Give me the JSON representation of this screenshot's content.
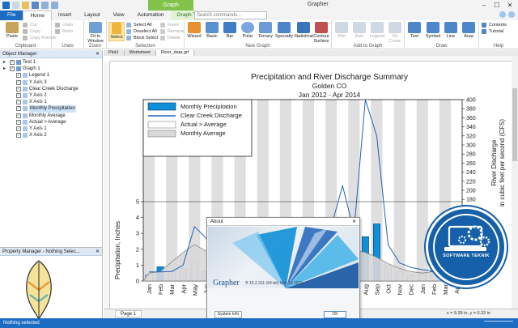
{
  "window": {
    "app_title": "Grapher",
    "contextual_tab": "Graph",
    "search_placeholder": "Search commands..."
  },
  "ribbon": {
    "tabs": [
      "File",
      "Home",
      "Insert",
      "Layout",
      "View",
      "Automation",
      "Graph Tools"
    ],
    "active_tab": "Home",
    "groups": {
      "clipboard": {
        "label": "Clipboard",
        "paste": "Paste",
        "cut": "Cut",
        "copy": "Copy",
        "copy_format": "Copy Format"
      },
      "undo": {
        "label": "Undo",
        "undo": "Undo",
        "redo": "Redo"
      },
      "zoom": {
        "label": "Zoom",
        "fit": "Fit to Window"
      },
      "selection": {
        "label": "Selection",
        "select": "Select",
        "select_all": "Select All",
        "deselect_all": "Deselect All",
        "block_select": "Block Select",
        "invert": "Invert",
        "rename": "Rename",
        "delete": "Delete"
      },
      "new_graph": {
        "label": "New Graph",
        "items": [
          "Wizard",
          "Basic",
          "Bar",
          "Polar",
          "Ternary",
          "Specialty",
          "Statistical",
          "Contour Surface"
        ]
      },
      "add_to_graph": {
        "label": "Add to Graph",
        "items": [
          "Plot",
          "Axis",
          "Legend",
          "Fit Curve"
        ]
      },
      "draw": {
        "label": "Draw",
        "items": [
          "Text",
          "Symbol",
          "Line",
          "Area"
        ]
      },
      "help": {
        "label": "Help",
        "contents": "Contents",
        "tutorial": "Tutorial"
      }
    }
  },
  "object_manager": {
    "title": "Object Manager",
    "items": [
      {
        "label": "Text 1",
        "level": 1,
        "checked": true,
        "selected": false
      },
      {
        "label": "Graph 1",
        "level": 1,
        "checked": true,
        "selected": false
      },
      {
        "label": "Legend 1",
        "level": 2,
        "checked": true,
        "selected": false
      },
      {
        "label": "Y Axis 3",
        "level": 2,
        "checked": true,
        "selected": false
      },
      {
        "label": "Clear Creek Discharge",
        "level": 2,
        "checked": true,
        "selected": false
      },
      {
        "label": "Y Axis 2",
        "level": 2,
        "checked": true,
        "selected": false
      },
      {
        "label": "X Axis 1",
        "level": 2,
        "checked": true,
        "selected": false
      },
      {
        "label": "Monthly Precipitation",
        "level": 2,
        "checked": true,
        "selected": true
      },
      {
        "label": "Monthly Average",
        "level": 2,
        "checked": true,
        "selected": false
      },
      {
        "label": "Actual > Average",
        "level": 2,
        "checked": true,
        "selected": false
      },
      {
        "label": "Y Axis 1",
        "level": 2,
        "checked": true,
        "selected": false
      },
      {
        "label": "X Axis 2",
        "level": 2,
        "checked": true,
        "selected": false
      }
    ]
  },
  "property_manager": {
    "title": "Property Manager - Nothing Selec..."
  },
  "document": {
    "tabs": [
      "Plot1",
      "Worksheet",
      "River_data.grf"
    ],
    "active_tab": "River_data.grf",
    "page_tab": "Page 1",
    "coordinates": "x = 9.39 in, y = 0.32 in"
  },
  "chart_data": {
    "type": "bar",
    "title": "Precipitation and River Discharge Summary",
    "subtitle_1": "Golden CO",
    "subtitle_2": "Jan 2012 - Apr 2014",
    "categories": [
      "Jan",
      "Feb",
      "Mar",
      "Apr",
      "May",
      "Jun",
      "Jul",
      "Aug",
      "Sep",
      "Oct",
      "Nov",
      "Dec",
      "Jan",
      "Feb",
      "Mar",
      "Apr",
      "May",
      "Jun",
      "Jul",
      "Aug",
      "Sep",
      "Oct",
      "Nov",
      "Dec",
      "Jan",
      "Feb",
      "Mar",
      "Apr"
    ],
    "ylabel_left": "Precipitation, Inches",
    "ylabel_right_1": "River Discharge",
    "ylabel_right_2": "in cubic feet per second (CFS)",
    "yticks_left": [
      "0",
      "1",
      "2",
      "3",
      "4",
      "5"
    ],
    "yticks_right": [
      "0",
      "20",
      "40",
      "60",
      "80",
      "100",
      "120",
      "140",
      "160",
      "180",
      "200",
      "220",
      "240",
      "260",
      "280",
      "300",
      "320",
      "340",
      "360",
      "380",
      "400"
    ],
    "ylim_left": [
      0,
      5
    ],
    "ylim_right": [
      0,
      400
    ],
    "legend": [
      "Monthly Precipitation",
      "Clear Creek Discharge",
      "Actual > Average",
      "Monthly Average"
    ],
    "series": [
      {
        "name": "Monthly Precipitation",
        "values": [
          0.4,
          0.9,
          0.6,
          0.8,
          1.2,
          0.6,
          1.6,
          2.2,
          1.0,
          0.8,
          0.6,
          0.3,
          0.5,
          0.7,
          1.0,
          2.2,
          1.8,
          1.5,
          2.0,
          2.8,
          3.6,
          1.0,
          0.6,
          0.4,
          0.5,
          0.6,
          0.9,
          1.5
        ]
      },
      {
        "name": "Monthly Average",
        "values": [
          0.5,
          0.6,
          1.2,
          1.8,
          2.3,
          1.9,
          2.0,
          1.8,
          1.5,
          1.1,
          0.8,
          0.6,
          0.5,
          0.6,
          1.2,
          1.8,
          2.3,
          1.9,
          2.0,
          1.8,
          1.5,
          1.1,
          0.8,
          0.6,
          0.5,
          0.6,
          1.2,
          1.8
        ]
      },
      {
        "name": "Clear Creek Discharge",
        "values": [
          20,
          20,
          21,
          35,
          120,
          95,
          45,
          32,
          26,
          22,
          20,
          20,
          20,
          20,
          22,
          30,
          120,
          210,
          110,
          400,
          320,
          80,
          40,
          30,
          25,
          22,
          25,
          35
        ]
      }
    ],
    "highlight_months": [
      0,
      2,
      4,
      6,
      8,
      10,
      12,
      14,
      16,
      18,
      20,
      22,
      24,
      26
    ],
    "colors": {
      "precip": "#dfdbf1",
      "precip_highlight": "#0e8fd6",
      "average": "#7f7f7f",
      "discharge": "#1f63b8",
      "band": "#d9d9d9"
    }
  },
  "logo": {
    "text": "SOFTWARE TEKNIK"
  },
  "about_dialog": {
    "title": "About",
    "brand": "Grapher",
    "version": "® 15.2.311 (64-bit) Nov 15 2019",
    "system_info": "System Info",
    "ok": "OK"
  },
  "status": {
    "text": "Nothing selected"
  }
}
